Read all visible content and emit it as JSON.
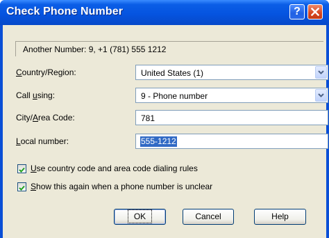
{
  "window": {
    "title": "Check Phone Number"
  },
  "header": {
    "text": "Another Number: 9, +1 (781) 555 1212"
  },
  "country": {
    "label_pre": "",
    "label_key": "C",
    "label_post": "ountry/Region:",
    "value": "United States (1)"
  },
  "call_using": {
    "label_pre": "Call ",
    "label_key": "u",
    "label_post": "sing:",
    "value": "9 - Phone number"
  },
  "city": {
    "label_pre": "City/",
    "label_key": "A",
    "label_post": "rea Code:",
    "value": "781"
  },
  "local": {
    "label_pre": "",
    "label_key": "L",
    "label_post": "ocal number:",
    "value": "555-1212"
  },
  "options": [
    {
      "label_key": "U",
      "label_post": "se country code and area code dialing rules",
      "checked": true
    },
    {
      "label_key": "S",
      "label_post": "how this again when a phone number is unclear",
      "checked": true
    }
  ],
  "buttons": {
    "ok": "OK",
    "cancel": "Cancel",
    "help": "Help"
  },
  "icons": {
    "help": "question-icon",
    "close": "close-icon",
    "dropdown": "chevron-down-icon",
    "check": "check-icon"
  }
}
